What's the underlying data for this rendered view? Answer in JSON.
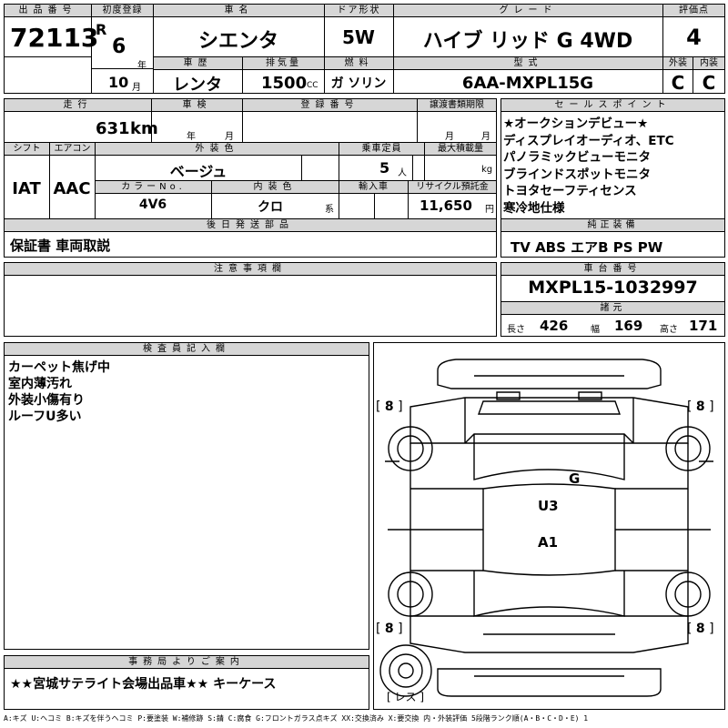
{
  "labels": {
    "lot_no": "出品番号",
    "first_reg": "初度登録",
    "car_name": "車名",
    "door": "ドア形状",
    "grade": "グレード",
    "score": "評価点",
    "history": "車歴",
    "displacement": "排気量",
    "fuel": "燃料",
    "model": "型式",
    "ext": "外装",
    "int": "内装",
    "mileage": "走行",
    "inspection": "車検",
    "reg_no": "登録番号",
    "transfer_deadline": "譲渡書類期限",
    "sales_points": "セールスポイント",
    "shift": "シフト",
    "aircon": "エアコン",
    "ext_color": "外装色",
    "capacity": "乗車定員",
    "max_load": "最大積載量",
    "color_no": "カラーNo.",
    "int_color": "内装色",
    "import": "輸入車",
    "recycle": "リサイクル預託金",
    "later_parts": "後日発送部品",
    "std_equip": "純正装備",
    "notes": "注意事項欄",
    "chassis_no": "車台番号",
    "specs": "諸元",
    "inspector": "検査員記入欄",
    "office": "事務局よりご案内"
  },
  "units": {
    "year": "年",
    "month": "月",
    "cc": "CC",
    "km": "km",
    "persons": "人",
    "kg": "kg",
    "yen": "円",
    "kei": "系",
    "length": "長さ",
    "width": "幅",
    "height": "高さ"
  },
  "lot_no": "72113",
  "era": "R",
  "reg_year": "6",
  "reg_month": "10",
  "car_name": "シエンタ",
  "door": "5W",
  "grade": "ハイブ リッド G 4WD",
  "score": "4",
  "history": "レンタ",
  "displacement": "1500",
  "fuel": "ガ ソリン",
  "model": "6AA-MXPL15G",
  "ext_score": "C",
  "int_score": "C",
  "mileage": "631",
  "shift": "IAT",
  "aircon": "AAC",
  "ext_color": "ベージュ",
  "capacity": "5",
  "color_no": "4V6",
  "int_color": "クロ",
  "recycle": "11,650",
  "later_parts": "保証書 車両取説",
  "sales_points": [
    "★オークションデビュー★",
    "ディスプレイオーディオ、ETC",
    "パノラミックビューモニタ",
    "ブラインドスポットモニタ",
    "トヨタセーフティセンス",
    "寒冷地仕様"
  ],
  "std_equip": "TV ABS エアB PS PW",
  "chassis_no": "MXPL15-1032997",
  "length": "426",
  "width": "169",
  "height": "171",
  "inspector_notes": [
    "カーペット焦げ中",
    "室内薄汚れ",
    "外装小傷有り",
    "ルーフU多い"
  ],
  "diagram": {
    "tire_fl": "8",
    "tire_fr": "8",
    "tire_rl": "8",
    "tire_rr": "8",
    "spare": "レス",
    "mark_g": "G",
    "mark_u3": "U3",
    "mark_a1": "A1"
  },
  "office_note": "★★宮城サテライト会場出品車★★ キーケース",
  "legend": "A:キズ U:ヘコミ B:キズを伴うヘコミ P:要塗装 W:補修跡 S:錆 C:腐食 G:フロントガラス点キズ XX:交換済み X:要交換 内・外装評価 5段階ランク順(A・B・C・D・E) 1"
}
